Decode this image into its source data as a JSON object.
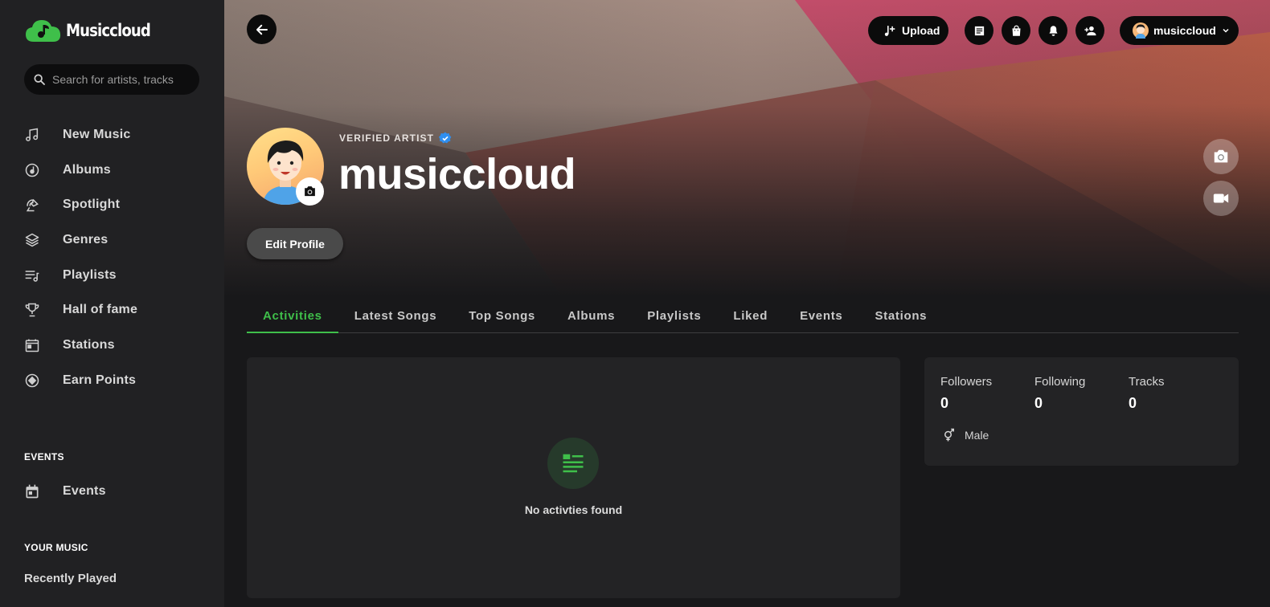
{
  "app": {
    "logo_text": "Musiccloud"
  },
  "search": {
    "placeholder": "Search for artists, tracks"
  },
  "sidebar": {
    "items": [
      {
        "label": "New Music",
        "icon": "music-note-icon"
      },
      {
        "label": "Albums",
        "icon": "album-icon"
      },
      {
        "label": "Spotlight",
        "icon": "spotlight-icon"
      },
      {
        "label": "Genres",
        "icon": "layers-icon"
      },
      {
        "label": "Playlists",
        "icon": "playlist-icon"
      },
      {
        "label": "Hall of fame",
        "icon": "trophy-icon"
      },
      {
        "label": "Stations",
        "icon": "radio-icon"
      },
      {
        "label": "Earn Points",
        "icon": "points-icon"
      }
    ],
    "events_title": "EVENTS",
    "events_item": "Events",
    "your_music_title": "YOUR MUSIC",
    "recently_played": "Recently Played"
  },
  "topbar": {
    "upload_label": "Upload",
    "username": "musiccloud"
  },
  "profile": {
    "verified_label": "VERIFIED ARTIST",
    "name": "musiccloud",
    "edit_label": "Edit Profile"
  },
  "tabs": [
    "Activities",
    "Latest Songs",
    "Top Songs",
    "Albums",
    "Playlists",
    "Liked",
    "Events",
    "Stations"
  ],
  "activities": {
    "empty_text": "No activties found"
  },
  "stats": {
    "followers_label": "Followers",
    "followers_value": "0",
    "following_label": "Following",
    "following_value": "0",
    "tracks_label": "Tracks",
    "tracks_value": "0",
    "gender": "Male"
  },
  "colors": {
    "accent": "#3fbf4a",
    "verified": "#2f8ff0",
    "sidebar_bg": "#212123",
    "page_bg": "#18181a"
  }
}
